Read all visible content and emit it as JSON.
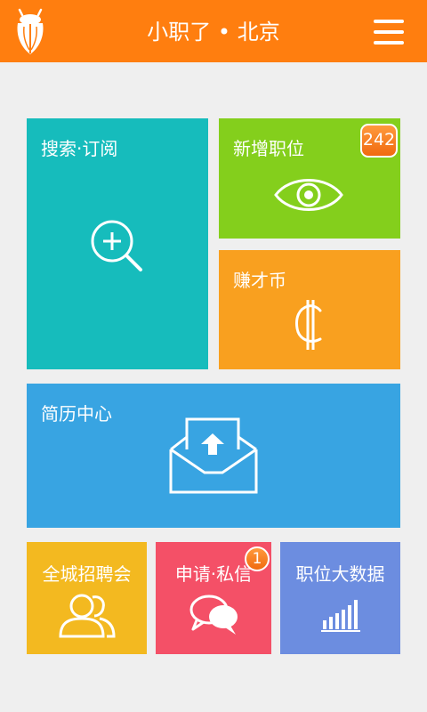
{
  "header": {
    "title": "小职了 • 北京",
    "logo_icon": "cicada-icon",
    "menu_icon": "hamburger-menu-icon",
    "bg_color": "#ff7e0f"
  },
  "tiles": {
    "search": {
      "label": "搜索·订阅",
      "icon": "search-plus-icon",
      "color": "#16bcbc"
    },
    "new_jobs": {
      "label": "新增职位",
      "icon": "eye-icon",
      "badge": "242",
      "color": "#84cf1c"
    },
    "coins": {
      "label": "赚才币",
      "icon": "cedi-currency-icon",
      "color": "#f9a01f"
    },
    "resume": {
      "label": "简历中心",
      "icon": "envelope-upload-icon",
      "color": "#38a4e2"
    },
    "job_fair": {
      "label": "全城招聘会",
      "icon": "users-icon",
      "color": "#f3b920"
    },
    "messages": {
      "label": "申请·私信",
      "icon": "chat-bubbles-icon",
      "badge": "1",
      "color": "#f45067"
    },
    "big_data": {
      "label": "职位大数据",
      "icon": "bar-chart-icon",
      "color": "#6c8de0"
    }
  }
}
